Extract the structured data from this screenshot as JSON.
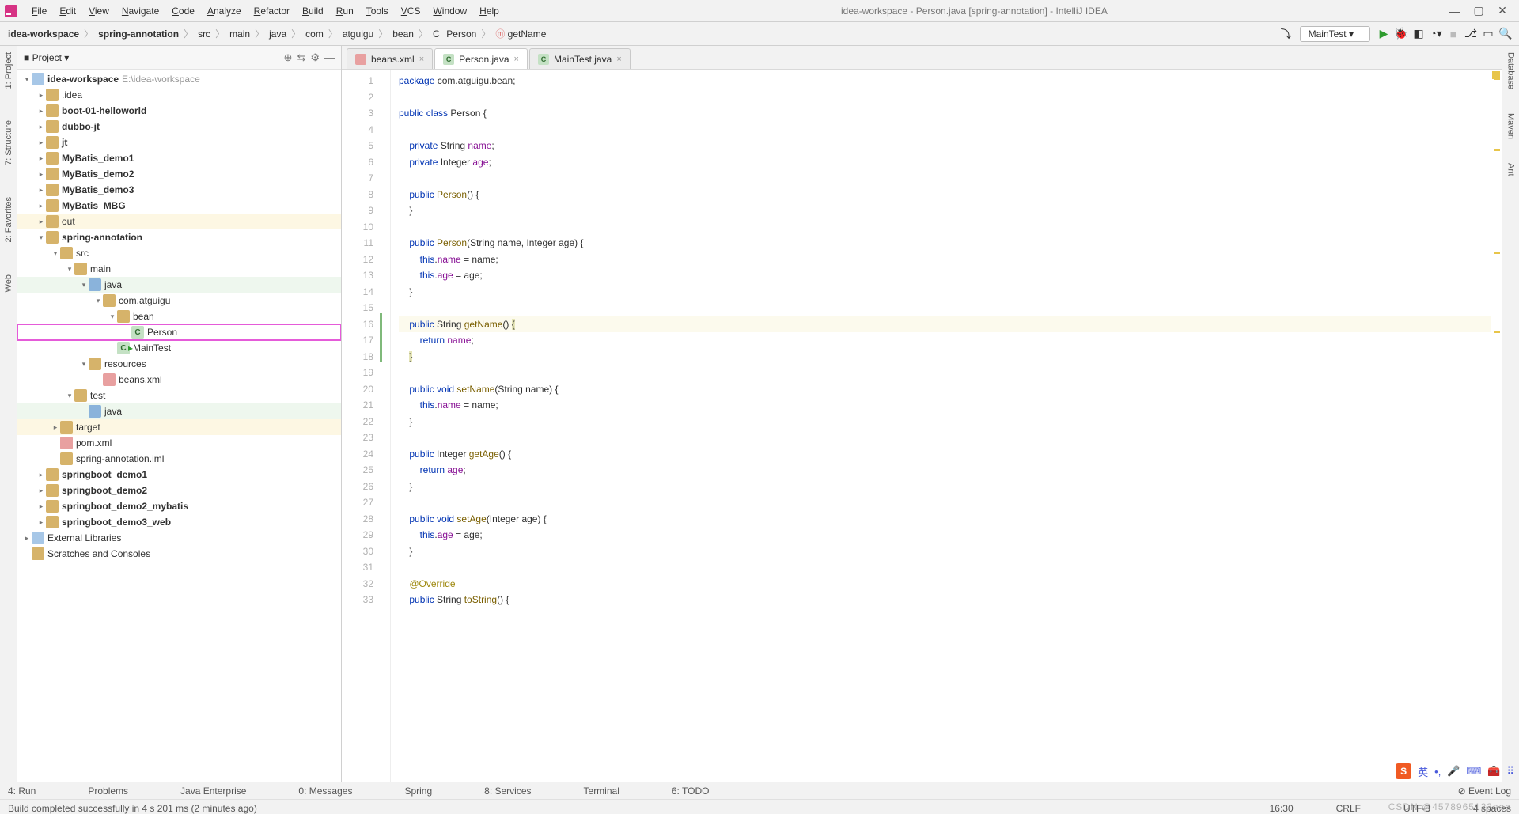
{
  "title": "idea-workspace - Person.java [spring-annotation] - IntelliJ IDEA",
  "menus": [
    "File",
    "Edit",
    "View",
    "Navigate",
    "Code",
    "Analyze",
    "Refactor",
    "Build",
    "Run",
    "Tools",
    "VCS",
    "Window",
    "Help"
  ],
  "breadcrumb": [
    "idea-workspace",
    "spring-annotation",
    "src",
    "main",
    "java",
    "com",
    "atguigu",
    "bean",
    "Person",
    "getName"
  ],
  "runconfig": "MainTest",
  "left_tools": [
    "1: Project",
    "7: Structure",
    "2: Favorites",
    "Web"
  ],
  "right_tools": [
    "Database",
    "Maven",
    "Ant"
  ],
  "project_label": "Project",
  "tree": {
    "root": "idea-workspace",
    "root_dim": "E:\\idea-workspace",
    "items": [
      {
        "d": 1,
        "t": ".idea",
        "a": "r"
      },
      {
        "d": 1,
        "t": "boot-01-helloworld",
        "a": "r",
        "b": true
      },
      {
        "d": 1,
        "t": "dubbo-jt",
        "a": "r",
        "b": true
      },
      {
        "d": 1,
        "t": "jt",
        "a": "r",
        "b": true
      },
      {
        "d": 1,
        "t": "MyBatis_demo1",
        "a": "r",
        "b": true
      },
      {
        "d": 1,
        "t": "MyBatis_demo2",
        "a": "r",
        "b": true
      },
      {
        "d": 1,
        "t": "MyBatis_demo3",
        "a": "r",
        "b": true
      },
      {
        "d": 1,
        "t": "MyBatis_MBG",
        "a": "r",
        "b": true
      },
      {
        "d": 1,
        "t": "out",
        "a": "r",
        "hl": "out"
      },
      {
        "d": 1,
        "t": "spring-annotation",
        "a": "d",
        "b": true
      },
      {
        "d": 2,
        "t": "src",
        "a": "d"
      },
      {
        "d": 3,
        "t": "main",
        "a": "d"
      },
      {
        "d": 4,
        "t": "java",
        "a": "d",
        "hl": "pkg",
        "ic": "srcfolder"
      },
      {
        "d": 5,
        "t": "com.atguigu",
        "a": "d"
      },
      {
        "d": 6,
        "t": "bean",
        "a": "d"
      },
      {
        "d": 7,
        "t": "Person",
        "ic": "class",
        "sel": true
      },
      {
        "d": 6,
        "t": "MainTest",
        "ic": "class",
        "run": true
      },
      {
        "d": 4,
        "t": "resources",
        "a": "d"
      },
      {
        "d": 5,
        "t": "beans.xml",
        "ic": "xml"
      },
      {
        "d": 3,
        "t": "test",
        "a": "d"
      },
      {
        "d": 4,
        "t": "java",
        "ic": "srcfolder",
        "hl": "pkg"
      },
      {
        "d": 2,
        "t": "target",
        "a": "r",
        "hl": "out"
      },
      {
        "d": 2,
        "t": "pom.xml",
        "ic": "xml"
      },
      {
        "d": 2,
        "t": "spring-annotation.iml"
      },
      {
        "d": 1,
        "t": "springboot_demo1",
        "a": "r",
        "b": true
      },
      {
        "d": 1,
        "t": "springboot_demo2",
        "a": "r",
        "b": true
      },
      {
        "d": 1,
        "t": "springboot_demo2_mybatis",
        "a": "r",
        "b": true
      },
      {
        "d": 1,
        "t": "springboot_demo3_web",
        "a": "r",
        "b": true
      }
    ],
    "ext1": "External Libraries",
    "ext2": "Scratches and Consoles"
  },
  "tabs": [
    {
      "label": "beans.xml",
      "icon": "x"
    },
    {
      "label": "Person.java",
      "icon": "c",
      "active": true
    },
    {
      "label": "MainTest.java",
      "icon": "c"
    }
  ],
  "code": [
    {
      "n": 1,
      "html": "<span class='kw'>package</span> com.atguigu.bean;"
    },
    {
      "n": 2,
      "html": ""
    },
    {
      "n": 3,
      "html": "<span class='kw'>public class</span> Person {"
    },
    {
      "n": 4,
      "html": ""
    },
    {
      "n": 5,
      "html": "    <span class='kw'>private</span> String <span class='fld'>name</span>;"
    },
    {
      "n": 6,
      "html": "    <span class='kw'>private</span> Integer <span class='fld'>age</span>;"
    },
    {
      "n": 7,
      "html": ""
    },
    {
      "n": 8,
      "html": "    <span class='kw'>public</span> <span class='fn'>Person</span>() {"
    },
    {
      "n": 9,
      "html": "    }"
    },
    {
      "n": 10,
      "html": ""
    },
    {
      "n": 11,
      "html": "    <span class='kw'>public</span> <span class='fn'>Person</span>(String name, Integer age) {"
    },
    {
      "n": 12,
      "html": "        <span class='kw'>this</span>.<span class='fld'>name</span> = name;"
    },
    {
      "n": 13,
      "html": "        <span class='kw'>this</span>.<span class='fld'>age</span> = age;"
    },
    {
      "n": 14,
      "html": "    }"
    },
    {
      "n": 15,
      "html": ""
    },
    {
      "n": 16,
      "html": "    <span class='kw'>public</span> String <span class='fn'>getName</span>() <span class='brace-hl'>{</span>",
      "hl": true,
      "chg": true
    },
    {
      "n": 17,
      "html": "        <span class='kw'>return</span> <span class='fld'>name</span>;",
      "chg": true
    },
    {
      "n": 18,
      "html": "    <span class='brace-hl'>}</span>",
      "chg": true
    },
    {
      "n": 19,
      "html": ""
    },
    {
      "n": 20,
      "html": "    <span class='kw'>public void</span> <span class='fn'>setName</span>(String name) {"
    },
    {
      "n": 21,
      "html": "        <span class='kw'>this</span>.<span class='fld'>name</span> = name;"
    },
    {
      "n": 22,
      "html": "    }"
    },
    {
      "n": 23,
      "html": ""
    },
    {
      "n": 24,
      "html": "    <span class='kw'>public</span> Integer <span class='fn'>getAge</span>() {"
    },
    {
      "n": 25,
      "html": "        <span class='kw'>return</span> <span class='fld'>age</span>;"
    },
    {
      "n": 26,
      "html": "    }"
    },
    {
      "n": 27,
      "html": ""
    },
    {
      "n": 28,
      "html": "    <span class='kw'>public void</span> <span class='fn'>setAge</span>(Integer age) {"
    },
    {
      "n": 29,
      "html": "        <span class='kw'>this</span>.<span class='fld'>age</span> = age;"
    },
    {
      "n": 30,
      "html": "    }"
    },
    {
      "n": 31,
      "html": ""
    },
    {
      "n": 32,
      "html": "    <span class='ann'>@Override</span>"
    },
    {
      "n": 33,
      "html": "    <span class='kw'>public</span> String <span class='fn'>toString</span>() {"
    }
  ],
  "bottom_tools": [
    "4: Run",
    "Problems",
    "Java Enterprise",
    "0: Messages",
    "Spring",
    "8: Services",
    "Terminal",
    "6: TODO"
  ],
  "event_log": "Event Log",
  "status_msg": "Build completed successfully in 4 s 201 ms (2 minutes ago)",
  "status_right": [
    "16:30",
    "CRLF",
    "UTF-8",
    "4 spaces"
  ],
  "watermark": "CSDN @4578965123aaa",
  "ime": {
    "logo": "S",
    "label": "英"
  }
}
